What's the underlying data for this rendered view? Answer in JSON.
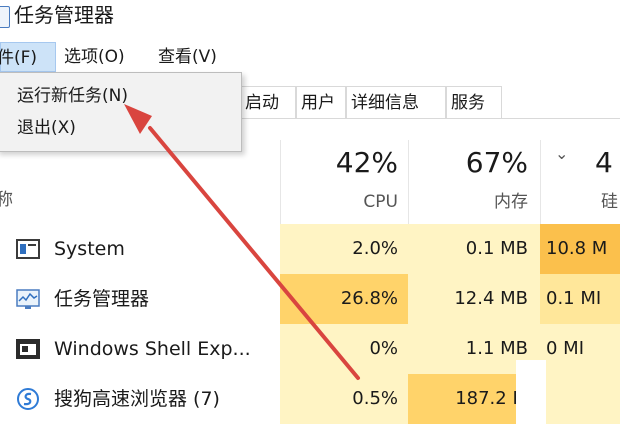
{
  "window": {
    "title": "任务管理器"
  },
  "menubar": {
    "file": "件(F)",
    "options": "选项(O)",
    "view": "查看(V)"
  },
  "file_menu": {
    "run_new_task": "运行新任务(N)",
    "exit": "退出(X)"
  },
  "tabs": [
    "启动",
    "用户",
    "详细信息",
    "服务"
  ],
  "columns": {
    "name": "称",
    "cpu": {
      "percent": "42%",
      "label": "CPU"
    },
    "memory": {
      "percent": "67%",
      "label": "内存"
    },
    "disk": {
      "percent": "4",
      "label": "硅"
    }
  },
  "processes": [
    {
      "name": "System",
      "icon": "system-window-icon",
      "cpu": "2.0%",
      "memory": "0.1 MB",
      "disk": "10.8 M"
    },
    {
      "name": "任务管理器",
      "icon": "task-manager-icon",
      "cpu": "26.8%",
      "memory": "12.4 MB",
      "disk": "0.1 MI"
    },
    {
      "name": "Windows Shell Exp...",
      "icon": "shell-window-icon",
      "cpu": "0%",
      "memory": "1.1 MB",
      "disk": "0 MI"
    },
    {
      "name": "搜狗高速浏览器 (7)",
      "icon": "sogou-browser-icon",
      "cpu": "0.5%",
      "memory": "187.2 M",
      "disk": ""
    }
  ],
  "annotation": {
    "arrow_color": "#d9453f"
  }
}
